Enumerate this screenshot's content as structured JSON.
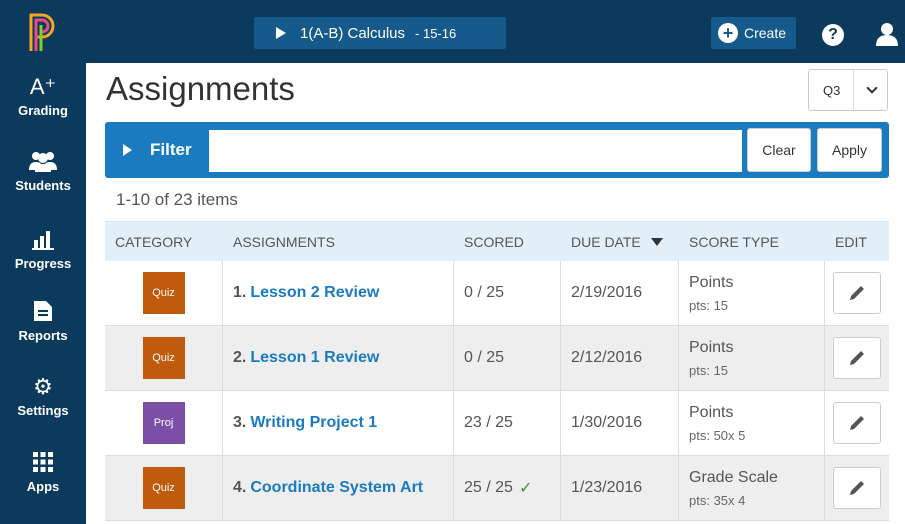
{
  "header": {
    "class_name": "1(A-B) Calculus",
    "class_year": "- 15-16",
    "create_label": "Create",
    "help_glyph": "?",
    "brand_color": "#0b3a5c",
    "accent_color": "#1a7bc0"
  },
  "sidebar": {
    "items": [
      {
        "label": "Grading",
        "icon": "grading-icon",
        "glyph": "A⁺"
      },
      {
        "label": "Students",
        "icon": "students-icon",
        "glyph": "👥"
      },
      {
        "label": "Progress",
        "icon": "progress-icon",
        "glyph": "▟"
      },
      {
        "label": "Reports",
        "icon": "reports-icon",
        "glyph": "✎"
      },
      {
        "label": "Settings",
        "icon": "settings-icon",
        "glyph": "⚙"
      },
      {
        "label": "Apps",
        "icon": "apps-icon",
        "glyph": "▦"
      }
    ]
  },
  "main": {
    "title": "Assignments",
    "term": "Q3",
    "filter": {
      "label": "Filter",
      "value": "",
      "clear_label": "Clear",
      "apply_label": "Apply"
    },
    "item_count": "1-10 of 23 items",
    "columns": {
      "category": "CATEGORY",
      "assignments": "ASSIGNMENTS",
      "scored": "SCORED",
      "due_date": "DUE DATE",
      "score_type": "SCORE TYPE",
      "edit": "EDIT"
    },
    "rows": [
      {
        "category": "Quiz",
        "category_color": "#c05a0c",
        "number": "1.",
        "name": "Lesson 2 Review",
        "scored": "0 / 25",
        "complete": "",
        "due": "2/19/2016",
        "type": "Points",
        "pts": "pts: 15"
      },
      {
        "category": "Quiz",
        "category_color": "#c05a0c",
        "number": "2.",
        "name": "Lesson 1 Review",
        "scored": "0 / 25",
        "complete": "",
        "due": "2/12/2016",
        "type": "Points",
        "pts": "pts: 15"
      },
      {
        "category": "Proj",
        "category_color": "#7b4fa6",
        "number": "3.",
        "name": "Writing Project 1",
        "scored": "23 / 25",
        "complete": "",
        "due": "1/30/2016",
        "type": "Points",
        "pts": "pts: 50x 5"
      },
      {
        "category": "Quiz",
        "category_color": "#c05a0c",
        "number": "4.",
        "name": "Coordinate System Art",
        "scored": "25 / 25",
        "complete": "✓",
        "due": "1/23/2016",
        "type": "Grade Scale",
        "pts": "pts: 35x 4"
      }
    ]
  }
}
